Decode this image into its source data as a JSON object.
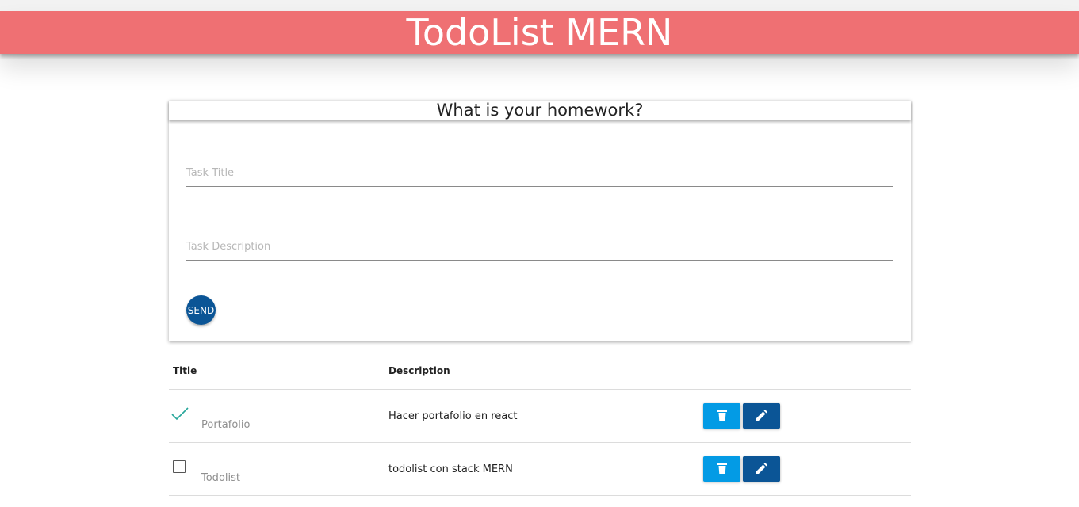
{
  "header": {
    "title": "TodoList MERN"
  },
  "form": {
    "heading": "What is your homework?",
    "title_placeholder": "Task Title",
    "description_placeholder": "Task Description",
    "send_label": "SEND"
  },
  "table": {
    "headers": {
      "title": "Title",
      "description": "Description"
    },
    "rows": [
      {
        "title": "Portafolio",
        "description": "Hacer portafolio en react",
        "done": true
      },
      {
        "title": "Todolist",
        "description": "todolist con stack MERN",
        "done": false
      }
    ]
  },
  "colors": {
    "header_bg": "#ef7073",
    "primary": "#0b5596",
    "delete": "#039be5",
    "check": "#26a69a"
  },
  "icons": {
    "delete": "trash-icon",
    "edit": "pencil-icon",
    "done": "check-icon",
    "pending": "checkbox-icon"
  }
}
